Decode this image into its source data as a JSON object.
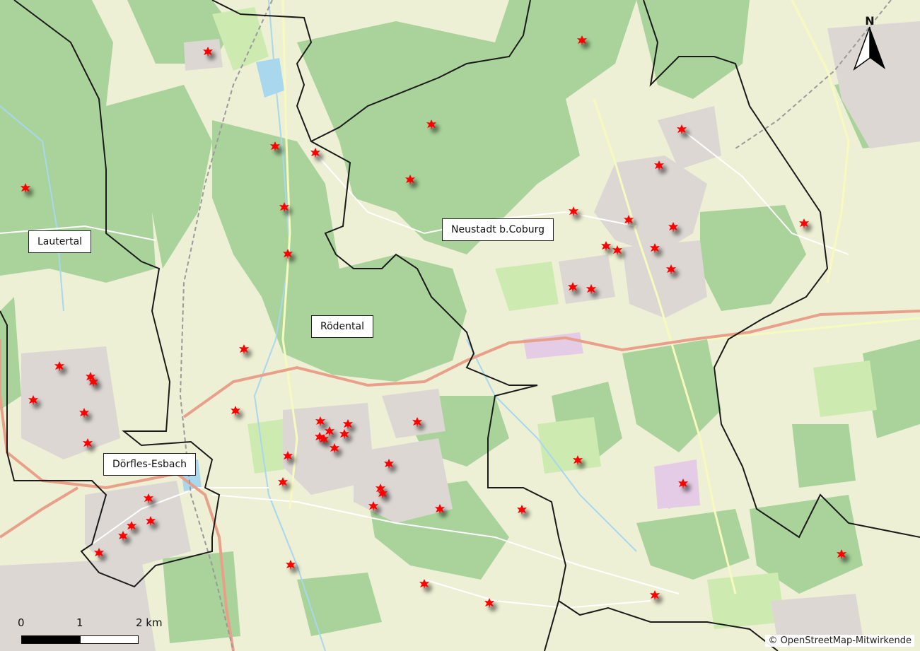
{
  "map": {
    "places": [
      {
        "name": "Lautertal"
      },
      {
        "name": "Neustadt b.Coburg"
      },
      {
        "name": "Rödental"
      },
      {
        "name": "Dörfles-Esbach"
      }
    ],
    "scale": {
      "labels": [
        "0",
        "1",
        "2 km"
      ]
    },
    "north_label": "N",
    "attribution": "© OpenStreetMap-Mitwirkende",
    "marker_color": "#ff0000",
    "marker_icon": "red-star-icon",
    "colors": {
      "land": "#f2efe9",
      "forest": "#a9d39a",
      "farmland": "#eef0d5",
      "meadow": "#cdebb0",
      "water": "#a8d7ee",
      "residential": "#dcd7d3",
      "boundary": "#1a1a1a",
      "motorway": "#e8a08a",
      "marker": "#ff0000"
    }
  }
}
